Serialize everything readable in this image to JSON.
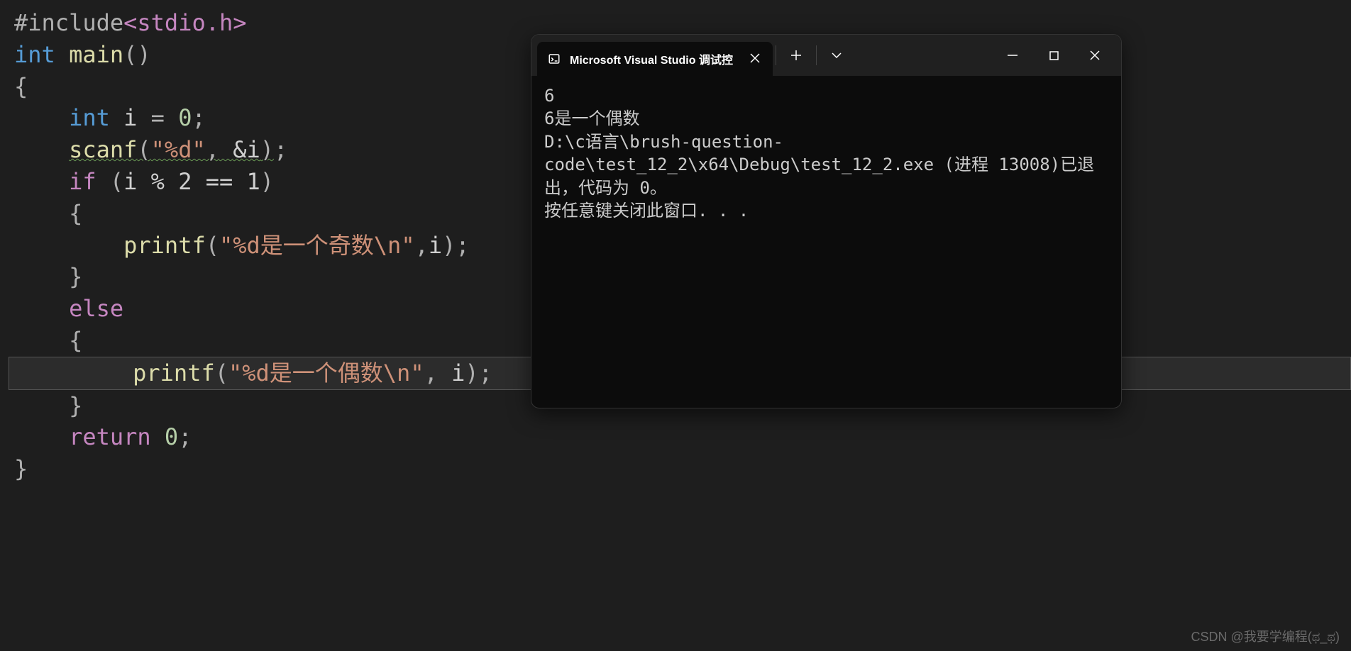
{
  "code": {
    "line1_preproc": "#include",
    "line1_path": "<stdio.h>",
    "line2_type": "int",
    "line2_func": "main",
    "line2_parens": "()",
    "line3_brace": "{",
    "line4_type": "int",
    "line4_var": "i",
    "line4_op": "=",
    "line4_num": "0",
    "line4_semi": ";",
    "line5_func": "scanf",
    "line5_open": "(",
    "line5_str": "\"%d\"",
    "line5_comma": ",",
    "line5_amp": "&i",
    "line5_close": ")",
    "line5_semi": ";",
    "line6_if": "if",
    "line6_open": "(",
    "line6_expr": "i % 2 == 1",
    "line6_close": ")",
    "line7_brace": "{",
    "line8_func": "printf",
    "line8_open": "(",
    "line8_str": "\"%d是一个奇数\\n\"",
    "line8_comma": ",",
    "line8_var": "i",
    "line8_close": ")",
    "line8_semi": ";",
    "line9_brace": "}",
    "line10_else": "else",
    "line11_brace": "{",
    "line12_func": "printf",
    "line12_open": "(",
    "line12_str": "\"%d是一个偶数\\n\"",
    "line12_comma": ",",
    "line12_var": "i",
    "line12_close": ")",
    "line12_semi": ";",
    "line13_brace": "}",
    "line14_return": "return",
    "line14_num": "0",
    "line14_semi": ";",
    "line15_brace": "}"
  },
  "console": {
    "tab_title": "Microsoft Visual Studio 调试控",
    "output_line1": "6",
    "output_line2": "6是一个偶数",
    "output_blank": "",
    "output_line3": "D:\\c语言\\brush-question-code\\test_12_2\\x64\\Debug\\test_12_2.exe (进程 13008)已退出，代码为 0。",
    "output_line4": "按任意键关闭此窗口. . ."
  },
  "watermark": "CSDN @我要学编程(ಥ_ಥ)"
}
